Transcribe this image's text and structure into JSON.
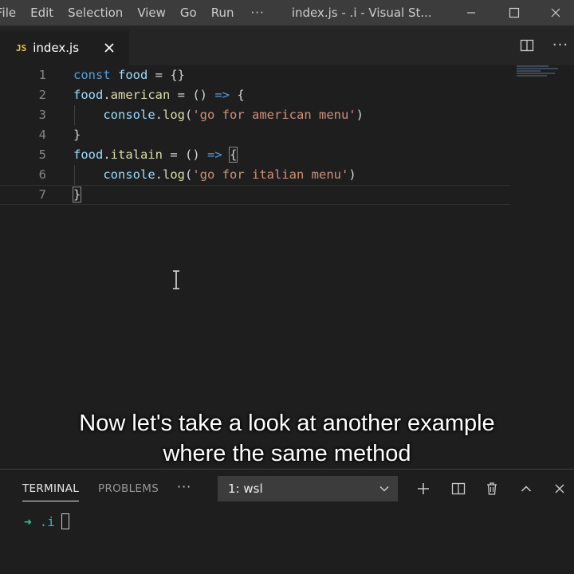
{
  "titlebar": {
    "menu": [
      "File",
      "Edit",
      "Selection",
      "View",
      "Go",
      "Run"
    ],
    "more": "···",
    "window_title": "index.js - .i - Visual St..."
  },
  "tab": {
    "badge": "JS",
    "label": "index.js"
  },
  "editor": {
    "lines": [
      {
        "num": "1",
        "tokens": [
          [
            "kw",
            "const"
          ],
          [
            "punc",
            " "
          ],
          [
            "var",
            "food"
          ],
          [
            "punc",
            " = {}"
          ]
        ]
      },
      {
        "num": "2",
        "tokens": [
          [
            "var",
            "food"
          ],
          [
            "punc",
            "."
          ],
          [
            "fn",
            "american"
          ],
          [
            "punc",
            " = () "
          ],
          [
            "kw",
            "=>"
          ],
          [
            "punc",
            " {"
          ]
        ]
      },
      {
        "num": "3",
        "tokens": [
          [
            "punc",
            "    "
          ],
          [
            "var",
            "console"
          ],
          [
            "punc",
            "."
          ],
          [
            "fn",
            "log"
          ],
          [
            "punc",
            "("
          ],
          [
            "str",
            "'go for american menu'"
          ],
          [
            "punc",
            ")"
          ]
        ]
      },
      {
        "num": "4",
        "tokens": [
          [
            "punc",
            "}"
          ]
        ]
      },
      {
        "num": "5",
        "tokens": [
          [
            "var",
            "food"
          ],
          [
            "punc",
            "."
          ],
          [
            "fn",
            "italain"
          ],
          [
            "punc",
            " = () "
          ],
          [
            "kw",
            "=>"
          ],
          [
            "punc",
            " "
          ],
          [
            "match",
            "{"
          ]
        ]
      },
      {
        "num": "6",
        "tokens": [
          [
            "punc",
            "    "
          ],
          [
            "var",
            "console"
          ],
          [
            "punc",
            "."
          ],
          [
            "fn",
            "log"
          ],
          [
            "punc",
            "("
          ],
          [
            "str",
            "'go for italian menu'"
          ],
          [
            "punc",
            ")"
          ]
        ]
      },
      {
        "num": "7",
        "tokens": [
          [
            "match",
            "}"
          ]
        ]
      }
    ]
  },
  "caption": {
    "line1": "Now let's take a look at another example",
    "line2": "where the same method"
  },
  "panel": {
    "tabs": [
      "TERMINAL",
      "PROBLEMS"
    ],
    "more": "···",
    "terminal_select": "1: wsl",
    "prompt_arrow": "➜",
    "prompt_dir": ".i"
  },
  "colors": {
    "keyword": "#569cd6",
    "variable": "#9cdcfe",
    "function": "#dcdcaa",
    "string": "#ce9178",
    "prompt_arrow": "#23d18b",
    "prompt_dir": "#29b8db"
  }
}
